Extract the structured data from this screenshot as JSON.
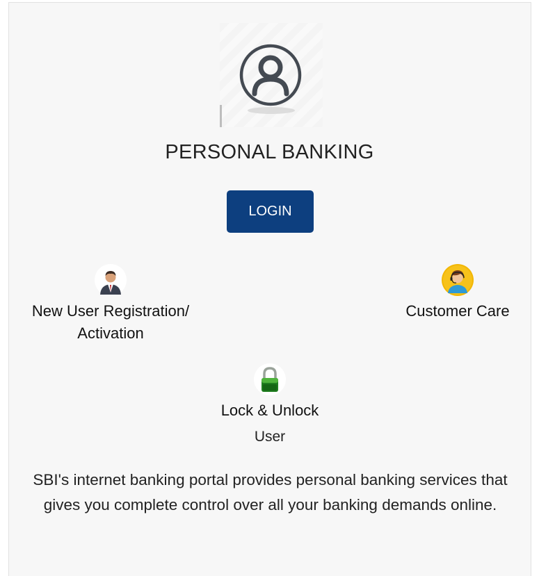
{
  "section_title": "PERSONAL BANKING",
  "login": {
    "label": "LOGIN"
  },
  "features": {
    "new_user": {
      "label": "New User Registration/ Activation",
      "icon": "businessman-avatar-icon"
    },
    "customer_care": {
      "label": "Customer Care",
      "icon": "support-agent-avatar-icon"
    },
    "lock_unlock": {
      "label": "Lock & Unlock",
      "sublabel": "User",
      "icon": "green-padlock-icon"
    }
  },
  "description": "SBI's internet banking portal provides personal banking services that gives you complete control over all your banking demands online.",
  "colors": {
    "login_button": "#0d3f7f",
    "panel_background": "#f7f7f7",
    "user_icon_stroke": "#444a52"
  }
}
